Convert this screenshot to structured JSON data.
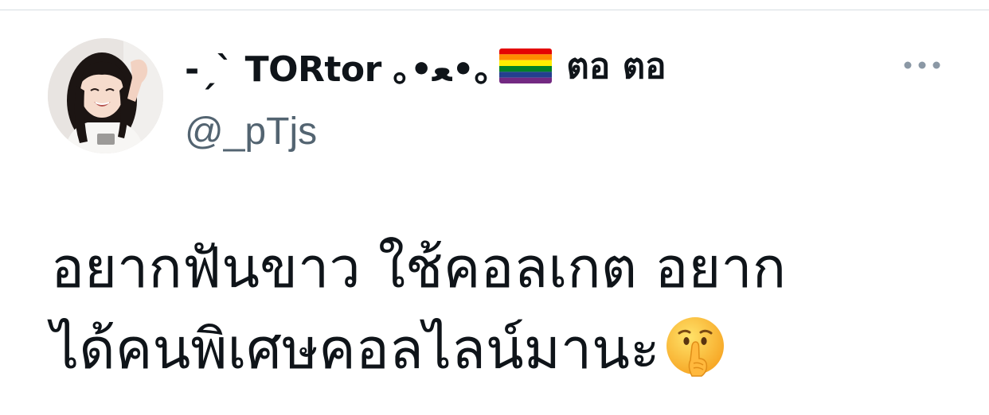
{
  "tweet": {
    "author": {
      "display_name": "-ˏˋ TORtor ｡•ﻌ•｡",
      "name_flag_icon": "rainbow-flag-icon",
      "display_name_suffix": "ตอ ตอ",
      "handle": "@_pTjs"
    },
    "more_icon": "more-horizontal-icon",
    "text_lines": [
      "อยากฟันขาว ใช้คอลเกต อยาก",
      "ได้คนพิเศษคอลไลน์มานะ"
    ],
    "text_emoji_icon": "shushing-face-icon"
  },
  "colors": {
    "text_primary": "#0f1419",
    "text_secondary": "#536471",
    "divider": "#d6dde2"
  }
}
